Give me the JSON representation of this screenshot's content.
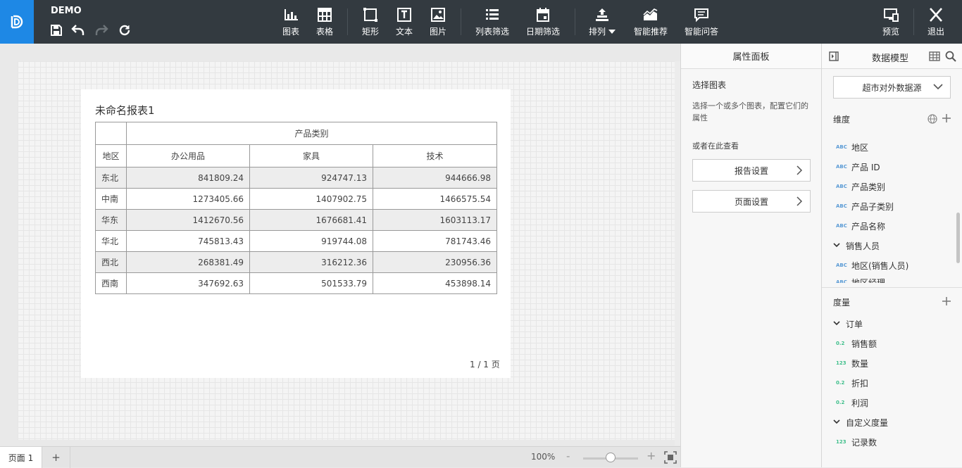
{
  "app": {
    "title": "DEMO"
  },
  "toolbar": [
    {
      "id": "chart",
      "label": "图表",
      "icon": "bar-chart-icon"
    },
    {
      "id": "table",
      "label": "表格",
      "icon": "table-icon"
    },
    {
      "id": "rect",
      "label": "矩形",
      "icon": "rectangle-icon"
    },
    {
      "id": "text",
      "label": "文本",
      "icon": "text-icon"
    },
    {
      "id": "image",
      "label": "图片",
      "icon": "image-icon"
    },
    {
      "id": "listfilter",
      "label": "列表筛选",
      "icon": "list-icon"
    },
    {
      "id": "datefilter",
      "label": "日期筛选",
      "icon": "calendar-icon"
    },
    {
      "id": "arrange",
      "label": "排列",
      "icon": "arrange-icon"
    },
    {
      "id": "recommend",
      "label": "智能推荐",
      "icon": "smart-chart-icon"
    },
    {
      "id": "qa",
      "label": "智能问答",
      "icon": "chat-icon"
    },
    {
      "id": "preview",
      "label": "预览",
      "icon": "preview-icon"
    },
    {
      "id": "exit",
      "label": "退出",
      "icon": "close-icon"
    }
  ],
  "report": {
    "title": "未命名报表1",
    "category_header": "产品类别",
    "columns": [
      "地区",
      "办公用品",
      "家具",
      "技术"
    ],
    "rows": [
      [
        "东北",
        "841809.24",
        "924747.13",
        "944666.98"
      ],
      [
        "中南",
        "1273405.66",
        "1407902.75",
        "1466575.54"
      ],
      [
        "华东",
        "1412670.56",
        "1676681.41",
        "1603113.17"
      ],
      [
        "华北",
        "745813.43",
        "919744.08",
        "781743.46"
      ],
      [
        "西北",
        "268381.49",
        "316212.36",
        "230956.36"
      ],
      [
        "西南",
        "347692.63",
        "501533.79",
        "453898.14"
      ]
    ],
    "page_info": "1 / 1 页"
  },
  "bottom": {
    "tab": "页面 1",
    "add": "+",
    "zoom": "100%",
    "minus": "-",
    "plus": "+"
  },
  "attr": {
    "title": "属性面板",
    "subtitle": "选择图表",
    "desc": "选择一个或多个图表，配置它们的属性",
    "or": "或者在此查看",
    "report_settings": "报告设置",
    "page_settings": "页面设置"
  },
  "model": {
    "title": "数据模型",
    "datasource": "超市对外数据源",
    "dim_title": "维度",
    "dims": [
      {
        "tag": "ABC",
        "name": "地区"
      },
      {
        "tag": "ABC",
        "name": "产品 ID"
      },
      {
        "tag": "ABC",
        "name": "产品类别"
      },
      {
        "tag": "ABC",
        "name": "产品子类别"
      },
      {
        "tag": "ABC",
        "name": "产品名称"
      }
    ],
    "dim_group": "销售人员",
    "dim_group_item": {
      "tag": "ABC",
      "name": "地区(销售人员)"
    },
    "dim_partial": "地区经理",
    "measure_title": "度量",
    "measure_group": "订单",
    "measures": [
      {
        "tag": "0.2",
        "name": "销售额"
      },
      {
        "tag": "123",
        "name": "数量"
      },
      {
        "tag": "0.2",
        "name": "折扣"
      },
      {
        "tag": "0.2",
        "name": "利润"
      }
    ],
    "custom_group": "自定义度量",
    "custom_item": {
      "tag": "123",
      "name": "记录数"
    }
  }
}
